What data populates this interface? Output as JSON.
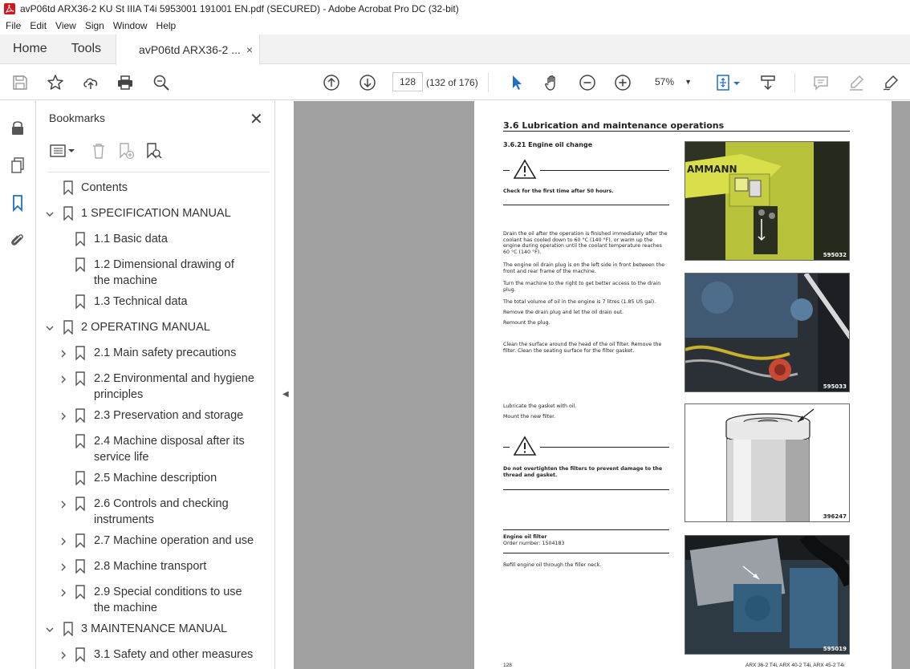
{
  "window": {
    "title": "avP06td ARX36-2 KU St IIIA T4i 5953001 191001 EN.pdf (SECURED) - Adobe Acrobat Pro DC (32-bit)"
  },
  "menu": [
    "File",
    "Edit",
    "View",
    "Sign",
    "Window",
    "Help"
  ],
  "tabs": {
    "home": "Home",
    "tools": "Tools",
    "doc": "avP06td ARX36-2 ...",
    "close": "×"
  },
  "toolbar": {
    "page_number": "128",
    "page_count": "(132 of 176)",
    "zoom": "57%"
  },
  "bookmarks": {
    "title": "Bookmarks",
    "items": [
      {
        "label": "Contents",
        "line2": ""
      },
      {
        "label": "1 SPECIFICATION MANUAL",
        "line2": ""
      },
      {
        "label": "1.1 Basic data",
        "line2": ""
      },
      {
        "label": "1.2 Dimensional drawing of",
        "line2": "the machine"
      },
      {
        "label": "1.3 Technical data",
        "line2": ""
      },
      {
        "label": "2 OPERATING MANUAL",
        "line2": ""
      },
      {
        "label": "2.1 Main safety precautions",
        "line2": ""
      },
      {
        "label": "2.2 Environmental and hygiene",
        "line2": "principles"
      },
      {
        "label": "2.3 Preservation and storage",
        "line2": ""
      },
      {
        "label": "2.4 Machine disposal after its",
        "line2": "service life"
      },
      {
        "label": "2.5 Machine description",
        "line2": ""
      },
      {
        "label": "2.6 Controls and checking",
        "line2": "instruments"
      },
      {
        "label": "2.7 Machine operation and use",
        "line2": ""
      },
      {
        "label": "2.8 Machine transport",
        "line2": ""
      },
      {
        "label": "2.9 Special conditions to use",
        "line2": "the machine"
      },
      {
        "label": "3 MAINTENANCE MANUAL",
        "line2": ""
      },
      {
        "label": "3.1 Safety and other measures",
        "line2": ""
      }
    ]
  },
  "page": {
    "section": "3.6     Lubrication and maintenance operations",
    "subsection": "3.6.21   Engine oil change",
    "warning1": "Check for the first time after 50 hours.",
    "para1": [
      "Drain the oil after the operation is finished immediately after the coolant has cooled down to 60 °C (140 °F), or warm up the engine during operation until the coolant temperature reaches 60 °C (140 °F).",
      "The engine oil drain plug is on the left side in front between the front and rear frame of the machine.",
      "Turn the machine to the right to get better access to the drain plug.",
      "The total volume of oil in the engine is 7 litres (1.85 US gal).",
      "Remove the drain plug and let the oil drain out.",
      "Remount the plug."
    ],
    "para2": "Clean the surface around the head of the oil filter. Remove the filter. Clean the seating surface for the filter gasket.",
    "para3": [
      "Lubricate the gasket with oil.",
      "Mount the new filter."
    ],
    "warning2": "Do not overtighten the filters to prevent damage to the thread and gasket.",
    "filter_title": "Engine oil filter",
    "filter_order": "Order number: 1504183",
    "refill": "Refill engine oil through the filler neck.",
    "photo_logo": "AMMANN",
    "photo_numbers": [
      "595032",
      "595033",
      "396247",
      "595019"
    ],
    "footer_left": "128",
    "footer_right": "ARX 36-2 T4i, ARX 40-2 T4i, ARX 45-2 T4i"
  }
}
